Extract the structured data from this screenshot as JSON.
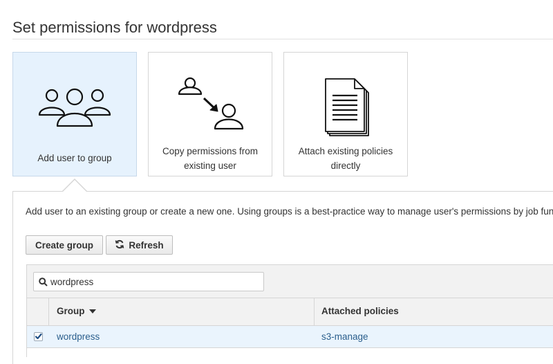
{
  "page": {
    "title": "Set permissions for wordpress"
  },
  "options": [
    {
      "id": "add",
      "label": "Add user to group",
      "icon": "users-group-icon",
      "selected": true
    },
    {
      "id": "copy",
      "label_line1": "Copy permissions from",
      "label_line2": "existing user",
      "icon": "copy-user-permissions-icon",
      "selected": false
    },
    {
      "id": "attach",
      "label_line1": "Attach existing policies",
      "label_line2": "directly",
      "icon": "policy-document-icon",
      "selected": false
    }
  ],
  "panel": {
    "description": "Add user to an existing group or create a new one. Using groups is a best-practice way to manage user's permissions by job func",
    "buttons": {
      "create_group": "Create group",
      "refresh": "Refresh"
    },
    "search": {
      "value": "wordpress",
      "placeholder": ""
    },
    "table": {
      "columns": {
        "group": "Group",
        "attached_policies": "Attached policies"
      },
      "sort_column": "Group",
      "rows": [
        {
          "group": "wordpress",
          "attached_policies": "s3-manage",
          "checked": true
        }
      ]
    }
  },
  "colors": {
    "selected_card_bg": "#e6f2fd",
    "row_selected_bg": "#eaf4fd",
    "link": "#2a5e8c"
  }
}
